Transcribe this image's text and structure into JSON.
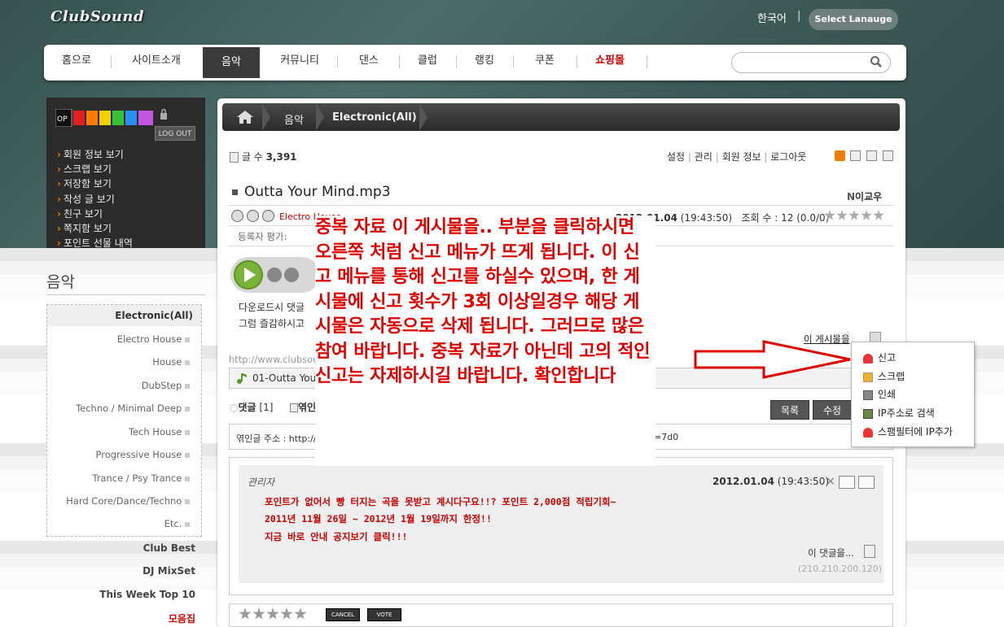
{
  "header": {
    "logo": "ClubSound",
    "language": "한국어",
    "language_sep": "|",
    "select_language": "Select Lanauge"
  },
  "nav": {
    "items": [
      "홈으로",
      "사이트소개",
      "음악",
      "커뮤니티",
      "댄스",
      "클럽",
      "랭킹",
      "쿠폰",
      "쇼핑몰"
    ],
    "active": "음악"
  },
  "user_box": {
    "logout": "LOG OUT",
    "menu": [
      "회원 정보 보기",
      "스크랩 보기",
      "저장함 보기",
      "작성 글 보기",
      "친구 보기",
      "쪽지함 보기",
      "포인트 선물 내역"
    ]
  },
  "sidebar": {
    "title": "음악",
    "active": "Electronic(All)",
    "categories": [
      "Electro House",
      "House",
      "DubStep",
      "Techno / Minimal Deep",
      "Tech House",
      "Progressive House",
      "Trance / Psy Trance",
      "Hard Core/Dance/Techno",
      "Etc."
    ],
    "links": [
      "Club Best",
      "DJ MixSet",
      "This Week Top 10",
      "모음집"
    ]
  },
  "breadcrumb": {
    "section": "음악",
    "sub": "Electronic(All)"
  },
  "board": {
    "count_label": "글 수",
    "count": "3,391",
    "links": [
      "설정",
      "관리",
      "회원 정보",
      "로그아웃"
    ],
    "sep": "|"
  },
  "post": {
    "title": "Outta Your Mind.mp3",
    "author_badge": "N",
    "author": "이교우",
    "genre": "Electro House",
    "date": "2012.01.04",
    "time": "(19:43:50)",
    "views_label": "조회 수 :",
    "views": "12",
    "rating": "(0.0/0)",
    "rater_label": "등록자 평가:",
    "download_text_1": "다운로드시 댓글",
    "download_text_2": "그럼 즐감하시고",
    "url": "http://www.clubsoun",
    "file": "01-Outta Your",
    "report_label": "이 게시물을",
    "trackback_label": "엮인글 주소 : http://",
    "trackback_tail": "=7d0",
    "list_button": "목록",
    "edit_button": "수정"
  },
  "comments": {
    "tab_label": "댓글",
    "tab_count": "[1]",
    "tab2": "엮인",
    "author": "관리자",
    "date": "2012.01.04",
    "time": "(19:43:50)",
    "close": "×",
    "lines": [
      "포인트가 없어서 빵 터지는 곡을 못받고 계시다구요!!? 포인트 2,000점 적립기회~",
      "2011년 11월 26일 ~ 2012년 1월 19일까지 한정!!",
      "지금 바로 안내 공지보기 클릭!!!"
    ],
    "this_comment": "이 댓글을...",
    "ip": "(210.210.200.120)"
  },
  "vote": {
    "cancel": "CANCEL",
    "vote": "VOTE"
  },
  "note": "중복 자료 이 게시물을.. 부분을 클릭하시면 오른쪽 처럼 신고 메뉴가 뜨게 됩니다. 이 신고 메뉴를 통해 신고를 하실수 있으며, 한 게시물에 신고 횟수가 3회 이상일경우 해당 게시물은 자동으로 삭제 됩니다. 그러므로 많은 참여 바랍니다.  중복 자료가 아닌데 고의 적인 신고는 자제하시길 바랍니다. 확인합니다",
  "popup": {
    "items": [
      "신고",
      "스크랩",
      "인쇄",
      "IP주소로 검색",
      "스팸필터에 IP추가"
    ]
  },
  "colors": {
    "accent_red": "#e00000",
    "nav_active": "#3a3a3a",
    "play_green": "#7ab33c"
  }
}
